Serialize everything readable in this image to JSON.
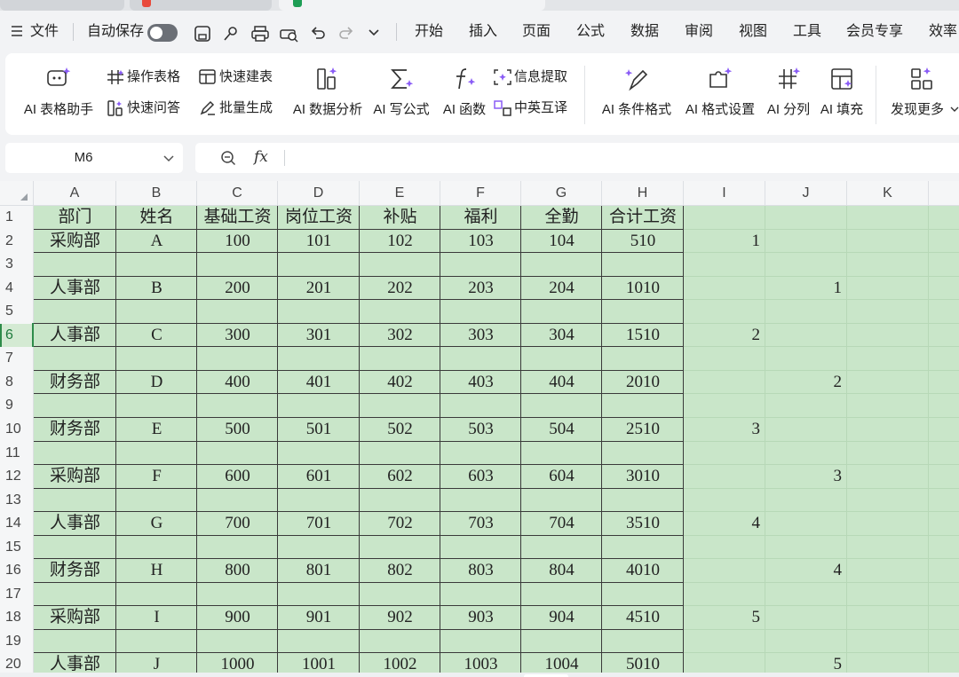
{
  "menu": {
    "file": "文件",
    "autosave": "自动保存",
    "tabs": [
      "开始",
      "插入",
      "页面",
      "公式",
      "数据",
      "审阅",
      "视图",
      "工具",
      "会员专享",
      "效率"
    ]
  },
  "ribbon": {
    "ai_table_assistant": "AI 表格助手",
    "operate_table": "操作表格",
    "quick_question": "快速问答",
    "quick_build": "快速建表",
    "batch_generate": "批量生成",
    "ai_data_analysis": "AI 数据分析",
    "ai_write_formula": "AI 写公式",
    "ai_function": "AI 函数",
    "info_extract": "信息提取",
    "cn_en_translate": "中英互译",
    "ai_conditional_format": "AI 条件格式",
    "ai_format_settings": "AI 格式设置",
    "ai_split": "AI 分列",
    "ai_fill": "AI 填充",
    "discover_more": "发现更多"
  },
  "formula_bar": {
    "name_box": "M6",
    "fx_symbol": "fx",
    "formula": ""
  },
  "sheet": {
    "columns": [
      "A",
      "B",
      "C",
      "D",
      "E",
      "F",
      "G",
      "H",
      "I",
      "J",
      "K"
    ],
    "row_numbers": [
      "1",
      "2",
      "3",
      "4",
      "5",
      "6",
      "7",
      "8",
      "9",
      "10",
      "11",
      "12",
      "13",
      "14",
      "15",
      "16",
      "17",
      "18",
      "19",
      "20"
    ],
    "selected_row": "6",
    "headers": [
      "部门",
      "姓名",
      "基础工资",
      "岗位工资",
      "补贴",
      "福利",
      "全勤",
      "合计工资"
    ],
    "records": [
      {
        "dept": "采购部",
        "name": "A",
        "base": "100",
        "post": "101",
        "allow": "102",
        "welfare": "103",
        "attend": "104",
        "total": "510",
        "i": "1",
        "j": ""
      },
      {
        "dept": "人事部",
        "name": "B",
        "base": "200",
        "post": "201",
        "allow": "202",
        "welfare": "203",
        "attend": "204",
        "total": "1010",
        "i": "",
        "j": "1"
      },
      {
        "dept": "人事部",
        "name": "C",
        "base": "300",
        "post": "301",
        "allow": "302",
        "welfare": "303",
        "attend": "304",
        "total": "1510",
        "i": "2",
        "j": ""
      },
      {
        "dept": "财务部",
        "name": "D",
        "base": "400",
        "post": "401",
        "allow": "402",
        "welfare": "403",
        "attend": "404",
        "total": "2010",
        "i": "",
        "j": "2"
      },
      {
        "dept": "财务部",
        "name": "E",
        "base": "500",
        "post": "501",
        "allow": "502",
        "welfare": "503",
        "attend": "504",
        "total": "2510",
        "i": "3",
        "j": ""
      },
      {
        "dept": "采购部",
        "name": "F",
        "base": "600",
        "post": "601",
        "allow": "602",
        "welfare": "603",
        "attend": "604",
        "total": "3010",
        "i": "",
        "j": "3"
      },
      {
        "dept": "人事部",
        "name": "G",
        "base": "700",
        "post": "701",
        "allow": "702",
        "welfare": "703",
        "attend": "704",
        "total": "3510",
        "i": "4",
        "j": ""
      },
      {
        "dept": "财务部",
        "name": "H",
        "base": "800",
        "post": "801",
        "allow": "802",
        "welfare": "803",
        "attend": "804",
        "total": "4010",
        "i": "",
        "j": "4"
      },
      {
        "dept": "采购部",
        "name": "I",
        "base": "900",
        "post": "901",
        "allow": "902",
        "welfare": "903",
        "attend": "904",
        "total": "4510",
        "i": "5",
        "j": ""
      },
      {
        "dept": "人事部",
        "name": "J",
        "base": "1000",
        "post": "1001",
        "allow": "1002",
        "welfare": "1003",
        "attend": "1004",
        "total": "5010",
        "i": "",
        "j": "5"
      }
    ]
  },
  "colors": {
    "cell_fill": "#c9e6c9",
    "selection": "#2e8b4a",
    "ai_accent": "#8a5cf6"
  }
}
